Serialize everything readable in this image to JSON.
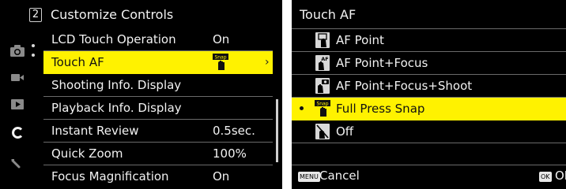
{
  "colors": {
    "highlight": "#fff200",
    "background": "#000000",
    "text": "#f2f2f2",
    "divider": "#6a6a6a"
  },
  "left_panel": {
    "page_number": "2",
    "title": "Customize Controls",
    "sidebar_icons": [
      "camera-icon",
      "video-icon",
      "playback-icon",
      "custom-c-icon",
      "wrench-icon"
    ],
    "active_tab": "custom-c-icon",
    "items": [
      {
        "label": "LCD Touch Operation",
        "value": "On"
      },
      {
        "label": "Touch AF",
        "value_icon": "snap-icon",
        "selected": true
      },
      {
        "label": "Shooting Info. Display",
        "value": ""
      },
      {
        "label": "Playback Info. Display",
        "value": ""
      },
      {
        "label": "Instant Review",
        "value": "0.5sec."
      },
      {
        "label": "Quick Zoom",
        "value": "100%"
      },
      {
        "label": "Focus Magnification",
        "value": "On"
      }
    ]
  },
  "right_panel": {
    "title": "Touch AF",
    "options": [
      {
        "label": "AF Point",
        "icon": "af-point-icon"
      },
      {
        "label": "AF Point+Focus",
        "icon": "af-point-focus-icon"
      },
      {
        "label": "AF Point+Focus+Shoot",
        "icon": "af-point-focus-shoot-icon"
      },
      {
        "label": "Full Press Snap",
        "icon": "snap-icon",
        "selected": true
      },
      {
        "label": "Off",
        "icon": "touch-off-icon"
      }
    ],
    "footer": {
      "menu_key": "MENU",
      "cancel_label": "Cancel",
      "ok_key": "OK",
      "ok_label": "OK"
    }
  }
}
